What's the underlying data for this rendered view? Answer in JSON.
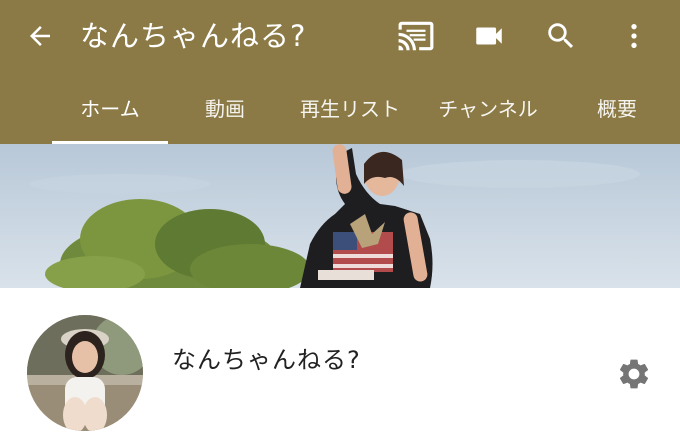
{
  "header": {
    "title": "なんちゃんねる?",
    "icons": [
      "back-arrow-icon",
      "cast-icon",
      "video-camera-icon",
      "search-icon",
      "more-vert-icon"
    ]
  },
  "tabs": [
    {
      "label": "ホーム",
      "active": true
    },
    {
      "label": "動画",
      "active": false
    },
    {
      "label": "再生リスト",
      "active": false
    },
    {
      "label": "チャンネル",
      "active": false
    },
    {
      "label": "概要",
      "active": false
    }
  ],
  "channel": {
    "name": "なんちゃんねる?"
  },
  "colors": {
    "appbar": "#8b7a45",
    "text_on_appbar": "#ffffff",
    "gear": "#757575"
  }
}
